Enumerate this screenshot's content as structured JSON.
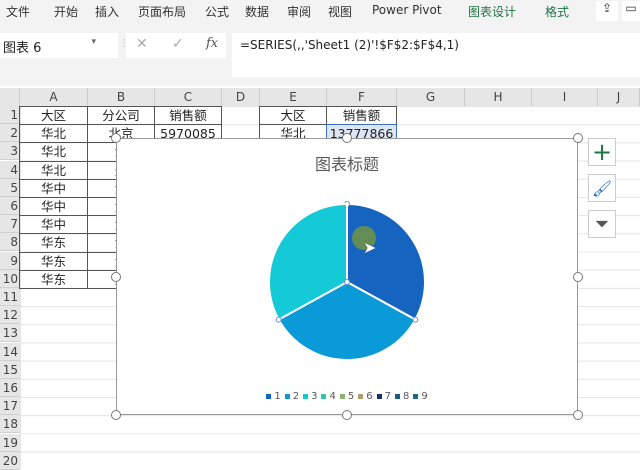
{
  "ribbon": {
    "tabs": [
      "文件",
      "开始",
      "插入",
      "页面布局",
      "公式",
      "数据",
      "审阅",
      "视图",
      "Power Pivot",
      "图表设计",
      "格式"
    ]
  },
  "namebox": "图表 6",
  "formula": "=SERIES(,,'Sheet1 (2)'!$F$2:$F$4,1)",
  "fx": "fx",
  "columns": [
    "A",
    "B",
    "C",
    "D",
    "E",
    "F",
    "G",
    "H",
    "I",
    "J"
  ],
  "rows": [
    "1",
    "2",
    "3",
    "4",
    "5",
    "6",
    "7",
    "8",
    "9",
    "10",
    "11",
    "12",
    "13",
    "14",
    "15",
    "16",
    "17",
    "18",
    "19",
    "20"
  ],
  "table1": {
    "headers": [
      "大区",
      "分公司",
      "销售额"
    ],
    "region": [
      "华北",
      "华北",
      "华北",
      "华中",
      "华中",
      "华中",
      "华东",
      "华东",
      "华东"
    ],
    "branch": [
      "北京",
      "河",
      "天",
      "河",
      "湖",
      "湖",
      "江",
      "浙",
      "上"
    ],
    "sales": [
      "5970085"
    ]
  },
  "table2": {
    "headers": [
      "大区",
      "销售额"
    ],
    "region": [
      "华北"
    ],
    "sales": [
      "13777866"
    ]
  },
  "chart_data": {
    "type": "pie",
    "title": "图表标题",
    "categories": [
      "1",
      "2",
      "3",
      "4",
      "5",
      "6",
      "7",
      "8",
      "9"
    ],
    "values": [
      0.33,
      0.34,
      0.33
    ],
    "colors": [
      "#1565c0",
      "#0b9ad8",
      "#14cad6",
      "#2fc4b2",
      "#8bb26e",
      "#b09a6e",
      "#1a2f6e",
      "#1b5b8c",
      "#1b6b7c"
    ]
  }
}
